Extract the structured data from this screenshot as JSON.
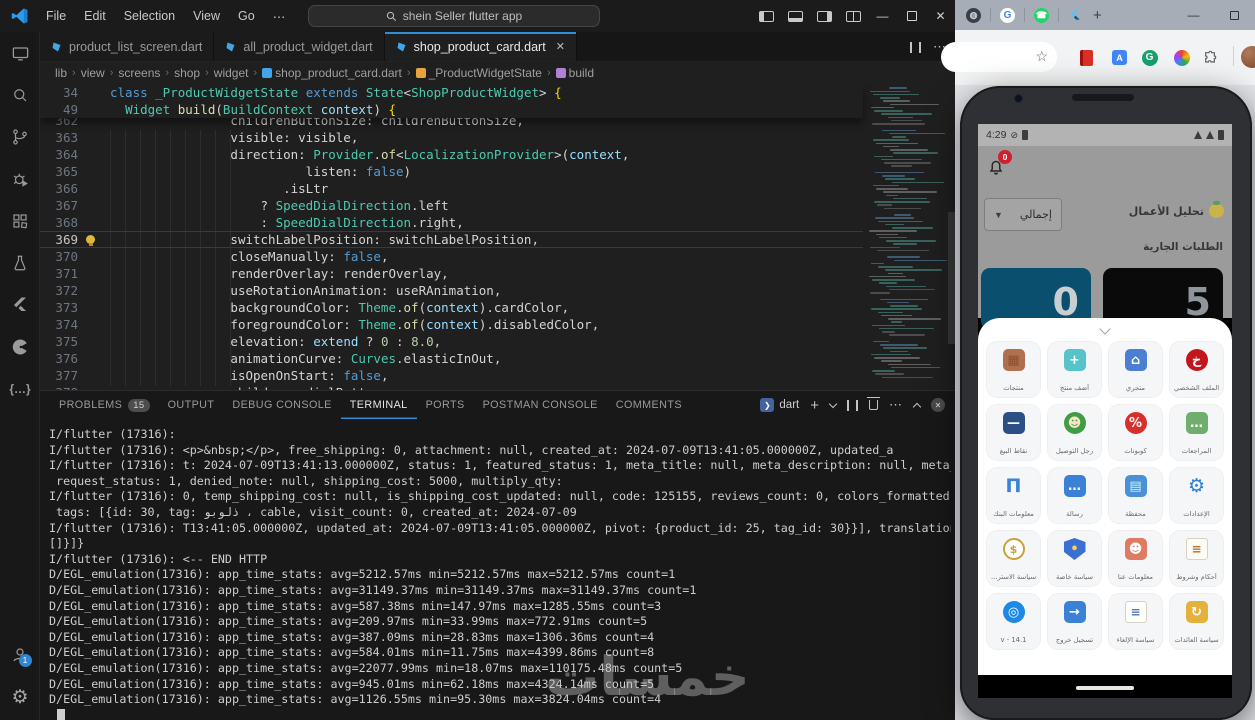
{
  "vscode": {
    "titlebar": {
      "menus": [
        "File",
        "Edit",
        "Selection",
        "View",
        "Go",
        "⋯"
      ],
      "search_text": "shein Seller flutter app"
    },
    "tabs": [
      {
        "label": "product_list_screen.dart"
      },
      {
        "label": "all_product_widget.dart"
      },
      {
        "label": "shop_product_card.dart"
      }
    ],
    "breadcrumb": [
      "lib",
      "view",
      "screens",
      "shop",
      "widget",
      "shop_product_card.dart",
      "_ProductWidgetState",
      "build"
    ],
    "code": {
      "sticky": [
        {
          "n": "34",
          "i": 0,
          "tk": [
            [
              "kw",
              "class "
            ],
            [
              "ty",
              "_ProductWidgetState"
            ],
            [
              "w",
              " "
            ],
            [
              "kw",
              "extends"
            ],
            [
              "w",
              " "
            ],
            [
              "ty",
              "State"
            ],
            [
              "w",
              "<"
            ],
            [
              "ty",
              "ShopProductWidget"
            ],
            [
              "w",
              ">"
            ],
            [
              "br",
              " {"
            ]
          ]
        },
        {
          "n": "49",
          "i": 2,
          "tk": [
            [
              "ty",
              "Widget"
            ],
            [
              "w",
              " "
            ],
            [
              "fn",
              "build"
            ],
            [
              "w",
              "("
            ],
            [
              "ty",
              "BuildContext"
            ],
            [
              "w",
              " "
            ],
            [
              "va",
              "context"
            ],
            [
              "w",
              ") "
            ],
            [
              "br",
              "{"
            ]
          ]
        }
      ],
      "lines": [
        {
          "n": "362",
          "i": 16,
          "tk": [
            [
              "w",
              "childrenButtonSize: childrenButtonSize,"
            ]
          ]
        },
        {
          "n": "363",
          "i": 16,
          "tk": [
            [
              "w",
              "visible: visible,"
            ]
          ]
        },
        {
          "n": "364",
          "i": 16,
          "tk": [
            [
              "w",
              "direction: "
            ],
            [
              "ty",
              "Provider"
            ],
            [
              "w",
              "."
            ],
            [
              "fn",
              "of"
            ],
            [
              "w",
              "<"
            ],
            [
              "ty",
              "LocalizationProvider"
            ],
            [
              "w",
              ">("
            ],
            [
              "va",
              "context"
            ],
            [
              "w",
              ","
            ]
          ]
        },
        {
          "n": "365",
          "i": 26,
          "tk": [
            [
              "w",
              "listen: "
            ],
            [
              "kw",
              "false"
            ],
            [
              "w",
              ")"
            ]
          ]
        },
        {
          "n": "366",
          "i": 23,
          "tk": [
            [
              "w",
              ".isLtr"
            ]
          ]
        },
        {
          "n": "367",
          "i": 20,
          "tk": [
            [
              "w",
              "? "
            ],
            [
              "ty",
              "SpeedDialDirection"
            ],
            [
              "w",
              ".left"
            ]
          ]
        },
        {
          "n": "368",
          "i": 20,
          "tk": [
            [
              "w",
              ": "
            ],
            [
              "ty",
              "SpeedDialDirection"
            ],
            [
              "w",
              ".right,"
            ]
          ]
        },
        {
          "n": "369",
          "i": 16,
          "cur": true,
          "tk": [
            [
              "w",
              "switchLabelPosition: switchLabelPosition,"
            ]
          ]
        },
        {
          "n": "370",
          "i": 16,
          "tk": [
            [
              "w",
              "closeManually: "
            ],
            [
              "kw",
              "false"
            ],
            [
              "w",
              ","
            ]
          ]
        },
        {
          "n": "371",
          "i": 16,
          "tk": [
            [
              "w",
              "renderOverlay: renderOverlay,"
            ]
          ]
        },
        {
          "n": "372",
          "i": 16,
          "tk": [
            [
              "w",
              "useRotationAnimation: useRAnimation,"
            ]
          ]
        },
        {
          "n": "373",
          "i": 16,
          "tk": [
            [
              "w",
              "backgroundColor: "
            ],
            [
              "ty",
              "Theme"
            ],
            [
              "w",
              "."
            ],
            [
              "fn",
              "of"
            ],
            [
              "w",
              "("
            ],
            [
              "va",
              "context"
            ],
            [
              "w",
              ").cardColor,"
            ]
          ]
        },
        {
          "n": "374",
          "i": 16,
          "tk": [
            [
              "w",
              "foregroundColor: "
            ],
            [
              "ty",
              "Theme"
            ],
            [
              "w",
              "."
            ],
            [
              "fn",
              "of"
            ],
            [
              "w",
              "("
            ],
            [
              "va",
              "context"
            ],
            [
              "w",
              ").disabledColor,"
            ]
          ]
        },
        {
          "n": "375",
          "i": 16,
          "tk": [
            [
              "w",
              "elevation: "
            ],
            [
              "va",
              "extend"
            ],
            [
              "w",
              " ? "
            ],
            [
              "nu",
              "0"
            ],
            [
              "w",
              " : "
            ],
            [
              "nu",
              "8.0"
            ],
            [
              "w",
              ","
            ]
          ]
        },
        {
          "n": "376",
          "i": 16,
          "tk": [
            [
              "w",
              "animationCurve: "
            ],
            [
              "ty",
              "Curves"
            ],
            [
              "w",
              ".elasticInOut,"
            ]
          ]
        },
        {
          "n": "377",
          "i": 16,
          "tk": [
            [
              "w",
              "isOpenOnStart: "
            ],
            [
              "kw",
              "false"
            ],
            [
              "w",
              ","
            ]
          ]
        },
        {
          "n": "378",
          "i": 16,
          "tk": [
            [
              "w",
              "children: dialButtons,"
            ]
          ]
        }
      ]
    },
    "panel": {
      "tabs": [
        {
          "label": "PROBLEMS",
          "badge": "15"
        },
        {
          "label": "OUTPUT"
        },
        {
          "label": "DEBUG CONSOLE"
        },
        {
          "label": "TERMINAL",
          "active": true
        },
        {
          "label": "PORTS"
        },
        {
          "label": "POSTMAN CONSOLE"
        },
        {
          "label": "COMMENTS"
        }
      ],
      "shell_label": "dart",
      "terminal_lines": [
        "I/flutter (17316):",
        "I/flutter (17316): <p>&nbsp;</p>, free_shipping: 0, attachment: null, created_at: 2024-07-09T13:41:05.000000Z, updated_a",
        "I/flutter (17316): t: 2024-07-09T13:41:13.000000Z, status: 1, featured_status: 1, meta_title: null, meta_description: null, meta_image: def.webp,",
        " request_status: 1, denied_note: null, shipping_cost: 5000, multiply_qty:",
        "I/flutter (17316): 0, temp_shipping_cost: null, is_shipping_cost_updated: null, code: 125155, reviews_count: 0, colors_formatted: [], rating: [],",
        " tags: [{id: 30, tag: ذلوبو ، cable, visit_count: 0, created_at: 2024-07-09",
        "I/flutter (17316): T13:41:05.000000Z, updated_at: 2024-07-09T13:41:05.000000Z, pivot: {product_id: 25, tag_id: 30}}], translations: [], reviews:",
        "[]}]}",
        "I/flutter (17316): <-- END HTTP",
        "D/EGL_emulation(17316): app_time_stats: avg=5212.57ms min=5212.57ms max=5212.57ms count=1",
        "D/EGL_emulation(17316): app_time_stats: avg=31149.37ms min=31149.37ms max=31149.37ms count=1",
        "D/EGL_emulation(17316): app_time_stats: avg=587.38ms min=147.97ms max=1285.55ms count=3",
        "D/EGL_emulation(17316): app_time_stats: avg=209.97ms min=33.99ms max=772.91ms count=5",
        "D/EGL_emulation(17316): app_time_stats: avg=387.09ms min=28.83ms max=1306.36ms count=4",
        "D/EGL_emulation(17316): app_time_stats: avg=584.01ms min=11.75ms max=4399.86ms count=8",
        "D/EGL_emulation(17316): app_time_stats: avg=22077.99ms min=18.07ms max=110175.48ms count=5",
        "D/EGL_emulation(17316): app_time_stats: avg=945.01ms min=62.18ms max=4324.14ms count=5",
        "D/EGL_emulation(17316): app_time_stats: avg=1126.55ms min=95.30ms max=3824.04ms count=4"
      ]
    },
    "account_badge": "1"
  },
  "watermark": "خمسات",
  "emulator": {
    "status_time": "4:29",
    "notification_badge": "0",
    "dropdown_value": "إجمالي",
    "analysis_label": "تحليل الأعمال",
    "orders_label": "الطلبات الجارية",
    "stat_left": "0",
    "stat_right": "5",
    "grid": [
      {
        "label": "منتجات",
        "shape": "sq",
        "bg": "#b1704d",
        "fg": "#8a4f33",
        "glyph": "▦"
      },
      {
        "label": "أضف منتج",
        "shape": "sq",
        "bg": "#56c3c9",
        "fg": "#ffffff",
        "glyph": "+"
      },
      {
        "label": "متجري",
        "shape": "sq",
        "bg": "#4a7fd4",
        "fg": "#ffffff",
        "glyph": "⌂"
      },
      {
        "label": "الملف الشخصي",
        "shape": "ci",
        "bg": "#c2151c",
        "fg": "#ffffff",
        "glyph": "خ"
      },
      {
        "label": "نقاط البيع",
        "shape": "sq",
        "bg": "#2d4f86",
        "fg": "#ffffff",
        "glyph": "—"
      },
      {
        "label": "رجل التوصيل",
        "shape": "ci",
        "bg": "#3f9d46",
        "fg": "#ffe3c2",
        "glyph": "☻"
      },
      {
        "label": "كوبونات",
        "shape": "ci",
        "bg": "#d6302c",
        "fg": "#ffffff",
        "glyph": "%"
      },
      {
        "label": "المراجعات",
        "shape": "sq",
        "bg": "#6fae6c",
        "fg": "#ffffff",
        "glyph": "…"
      },
      {
        "label": "معلومات البنك",
        "shape": "pl",
        "bg": "transparent",
        "fg": "#3b82d6",
        "glyph": "Π"
      },
      {
        "label": "رسالة",
        "shape": "sq",
        "bg": "#3b82d6",
        "fg": "#ffffff",
        "glyph": "…"
      },
      {
        "label": "محفظة",
        "shape": "sq",
        "bg": "#4a90d9",
        "fg": "#d9f2db",
        "glyph": "▤"
      },
      {
        "label": "الإعدادات",
        "shape": "pl",
        "bg": "transparent",
        "fg": "#2f7fd0",
        "glyph": "⚙"
      },
      {
        "label": "سياسة الاستر...",
        "shape": "ring",
        "bg": "#ffffff",
        "fg": "#c9a23c",
        "glyph": "$"
      },
      {
        "label": "سياسة خاصة",
        "shape": "shield",
        "bg": "#3b6fd4",
        "fg": "#ffd24a",
        "glyph": "•"
      },
      {
        "label": "معلومات عنا",
        "shape": "sq",
        "bg": "#e07b63",
        "fg": "#ffffff",
        "glyph": "☻"
      },
      {
        "label": "أحكام وشروط",
        "shape": "doc",
        "bg": "#fdfbf6",
        "fg": "#b0722f",
        "glyph": "≡"
      },
      {
        "label": "v - 14.1",
        "shape": "ci",
        "bg": "#1e88e5",
        "fg": "#ffffff",
        "glyph": "◎"
      },
      {
        "label": "تسجيل خروج",
        "shape": "sq",
        "bg": "#3b82d6",
        "fg": "#ffffff",
        "glyph": "→"
      },
      {
        "label": "سياسة الإلغاء",
        "shape": "doc",
        "bg": "#fdfdfd",
        "fg": "#4f7bb5",
        "glyph": "≡"
      },
      {
        "label": "سياسة العائدات",
        "shape": "sq",
        "bg": "#e4b23c",
        "fg": "#ffffff",
        "glyph": "↻"
      }
    ]
  }
}
